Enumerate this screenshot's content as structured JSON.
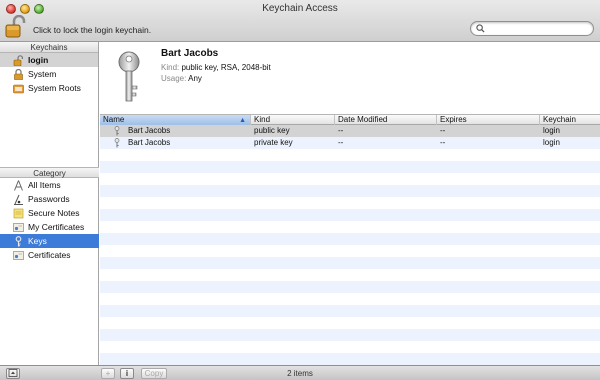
{
  "window": {
    "title": "Keychain Access"
  },
  "toolbar": {
    "lock_label": "Click to lock the login keychain.",
    "search_placeholder": ""
  },
  "sidebar": {
    "keychains_header": "Keychains",
    "keychains": [
      {
        "label": "login",
        "icon": "padlock-open-icon",
        "selected": true
      },
      {
        "label": "System",
        "icon": "padlock-icon"
      },
      {
        "label": "System Roots",
        "icon": "folder-icon"
      }
    ],
    "category_header": "Category",
    "categories": [
      {
        "label": "All Items",
        "icon": "all-items-icon"
      },
      {
        "label": "Passwords",
        "icon": "password-icon"
      },
      {
        "label": "Secure Notes",
        "icon": "note-icon"
      },
      {
        "label": "My Certificates",
        "icon": "certificate-icon"
      },
      {
        "label": "Keys",
        "icon": "key-icon",
        "selected": true
      },
      {
        "label": "Certificates",
        "icon": "certificate-icon"
      }
    ]
  },
  "info": {
    "name": "Bart Jacobs",
    "kind_label": "Kind:",
    "kind_value": "public key, RSA, 2048-bit",
    "usage_label": "Usage:",
    "usage_value": "Any"
  },
  "table": {
    "columns": [
      "Name",
      "Kind",
      "Date Modified",
      "Expires",
      "Keychain"
    ],
    "sorted_column": "Name",
    "sort_indicator": "▲",
    "rows": [
      {
        "name": "Bart Jacobs",
        "kind": "public key",
        "date_modified": "--",
        "expires": "--",
        "keychain": "login",
        "selected": true
      },
      {
        "name": "Bart Jacobs",
        "kind": "private key",
        "date_modified": "--",
        "expires": "--",
        "keychain": "login"
      }
    ]
  },
  "bottombar": {
    "add_label": "+",
    "info_label": "i",
    "copy_label": "Copy",
    "status": "2 items"
  },
  "colors": {
    "selection_blue": "#3d7bd9",
    "selection_grey": "#d3d3d3",
    "row_stripe": "#edf3fe"
  }
}
